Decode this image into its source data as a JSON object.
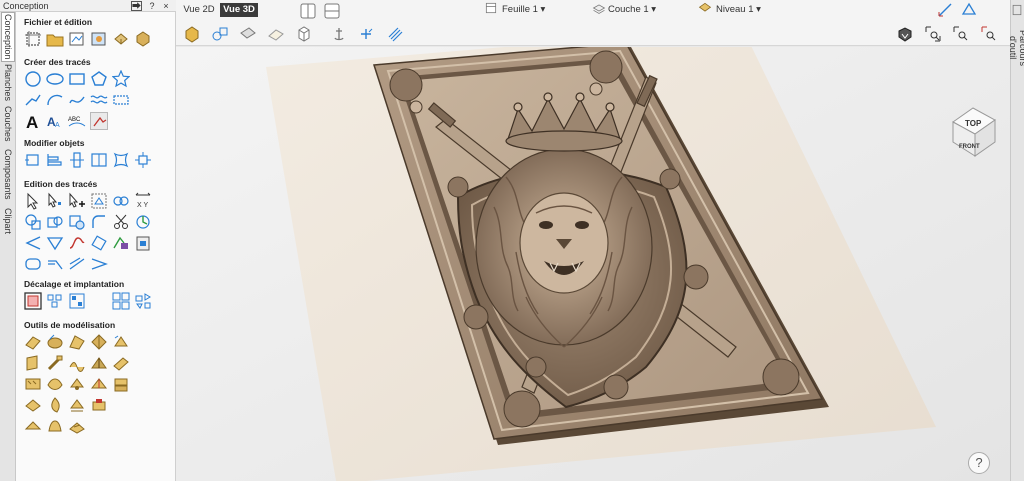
{
  "panel": {
    "title": "Conception",
    "pin_label": "?",
    "close_label": "×"
  },
  "left_tabs": [
    "Conception",
    "Planches",
    "Couches",
    "Composants",
    "Clipart"
  ],
  "sections": {
    "file": "Fichier et édition",
    "create": "Créer des tracés",
    "modify": "Modifier objets",
    "edit": "Edition des tracés",
    "offset": "Décalage et implantation",
    "model": "Outils de modélisation"
  },
  "top": {
    "view2d": "Vue 2D",
    "view3d": "Vue 3D",
    "sheet": "Feuille 1",
    "layer": "Couche 1",
    "level": "Niveau 1"
  },
  "right_tab": "Parcours d'outil",
  "view_cube": {
    "top_label": "TOP",
    "front_label": "FRONT"
  },
  "help_label": "?",
  "colors": {
    "accent": "#2a7fd4",
    "active_tab": "#3b3b3b",
    "model": "#a08a73"
  }
}
